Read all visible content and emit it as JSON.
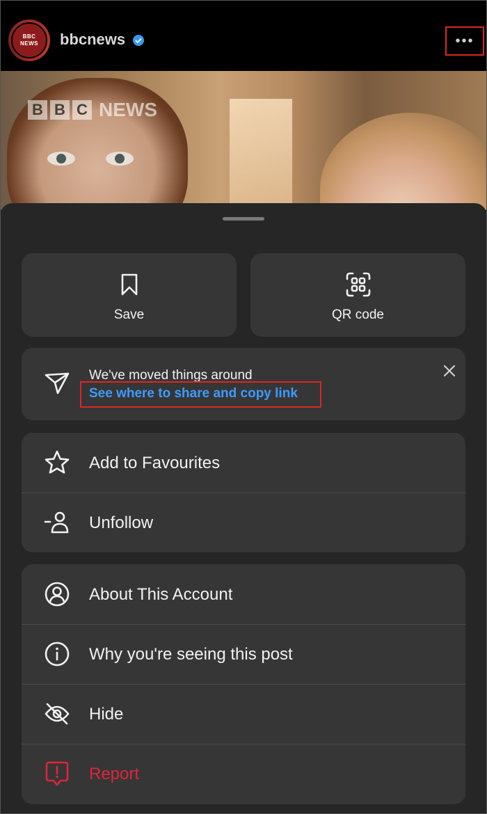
{
  "header": {
    "avatar_line1": "BBC",
    "avatar_line2": "NEWS",
    "username": "bbcnews",
    "more_label": "•••"
  },
  "post_image": {
    "logo_letters": [
      "B",
      "B",
      "C"
    ],
    "logo_word": "NEWS"
  },
  "sheet": {
    "tiles": [
      {
        "label": "Save",
        "icon": "bookmark-icon"
      },
      {
        "label": "QR code",
        "icon": "qr-code-icon"
      }
    ],
    "notice": {
      "title": "We've moved things around",
      "link": "See where to share and copy link",
      "icon": "send-icon",
      "close_icon": "close-icon"
    },
    "group1": [
      {
        "label": "Add to Favourites",
        "icon": "star-icon"
      },
      {
        "label": "Unfollow",
        "icon": "unfollow-icon"
      }
    ],
    "group2": [
      {
        "label": "About This Account",
        "icon": "account-icon"
      },
      {
        "label": "Why you're seeing this post",
        "icon": "info-icon"
      },
      {
        "label": "Hide",
        "icon": "eye-off-icon"
      },
      {
        "label": "Report",
        "icon": "report-icon"
      }
    ]
  },
  "colors": {
    "highlight_border": "#e02424",
    "link": "#3d9bff",
    "danger": "#e0243c",
    "sheet_bg": "#262626",
    "card_bg": "#363636"
  }
}
